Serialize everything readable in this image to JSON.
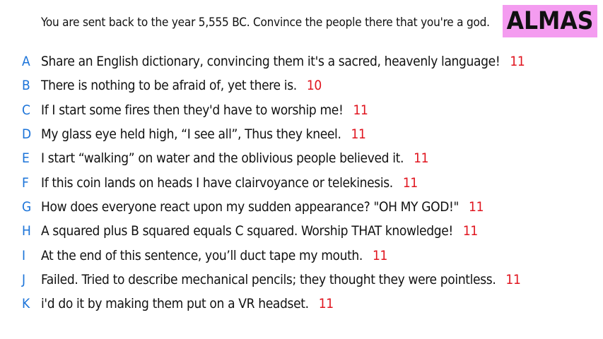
{
  "prompt": "You are sent back to the year 5,555 BC. Convince the people there that you're a god.",
  "badge": "ALMAS",
  "colors": {
    "letter": "#1a73d9",
    "score": "#e0141e",
    "badge_bg": "#f49cf0"
  },
  "answers": [
    {
      "letter": "A",
      "text": "Share an English dictionary, convincing them it's a sacred, heavenly language!",
      "score": "11"
    },
    {
      "letter": "B",
      "text": "There is nothing to be afraid of, yet there is.",
      "score": "10"
    },
    {
      "letter": "C",
      "text": "If I start some fires then they'd have to worship me!",
      "score": "11"
    },
    {
      "letter": "D",
      "text": "My glass eye held high, “I see all”, Thus they kneel.",
      "score": "11"
    },
    {
      "letter": "E",
      "text": "I start “walking” on water and the oblivious people believed it.",
      "score": "11"
    },
    {
      "letter": "F",
      "text": "If this coin lands on heads I have clairvoyance or telekinesis.",
      "score": "11"
    },
    {
      "letter": "G",
      "text": "How does everyone react upon my sudden appearance? \"OH MY GOD!\"",
      "score": "11"
    },
    {
      "letter": "H",
      "text": "A squared plus B squared equals C squared. Worship THAT knowledge!",
      "score": "11"
    },
    {
      "letter": "I",
      "text": "At the end of this sentence, you’ll duct tape my mouth.",
      "score": "11"
    },
    {
      "letter": "J",
      "text": "Failed. Tried to describe mechanical pencils; they thought they were pointless.",
      "score": "11"
    },
    {
      "letter": "K",
      "text": "i'd do it by making them put on a VR headset.",
      "score": "11"
    }
  ]
}
